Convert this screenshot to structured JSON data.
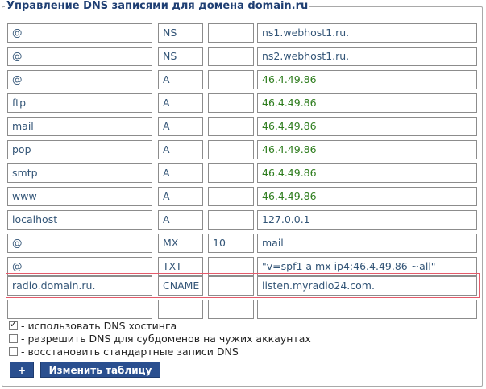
{
  "title": "Управление DNS записями для домена domain.ru",
  "rows": [
    {
      "name": "@",
      "type": "NS",
      "prio": "",
      "value": "ns1.webhost1.ru.",
      "value_color": "default"
    },
    {
      "name": "@",
      "type": "NS",
      "prio": "",
      "value": "ns2.webhost1.ru.",
      "value_color": "default"
    },
    {
      "name": "@",
      "type": "A",
      "prio": "",
      "value": "46.4.49.86",
      "value_color": "green"
    },
    {
      "name": "ftp",
      "type": "A",
      "prio": "",
      "value": "46.4.49.86",
      "value_color": "green"
    },
    {
      "name": "mail",
      "type": "A",
      "prio": "",
      "value": "46.4.49.86",
      "value_color": "green"
    },
    {
      "name": "pop",
      "type": "A",
      "prio": "",
      "value": "46.4.49.86",
      "value_color": "green"
    },
    {
      "name": "smtp",
      "type": "A",
      "prio": "",
      "value": "46.4.49.86",
      "value_color": "green"
    },
    {
      "name": "www",
      "type": "A",
      "prio": "",
      "value": "46.4.49.86",
      "value_color": "green"
    },
    {
      "name": "localhost",
      "type": "A",
      "prio": "",
      "value": "127.0.0.1",
      "value_color": "default"
    },
    {
      "name": "@",
      "type": "MX",
      "prio": "10",
      "value": "mail",
      "value_color": "default"
    },
    {
      "name": "@",
      "type": "TXT",
      "prio": "",
      "value": "\"v=spf1 a mx ip4:46.4.49.86 ~all\"",
      "value_color": "default"
    },
    {
      "name": "radio.domain.ru.",
      "type": "CNAME",
      "prio": "",
      "value": "listen.myradio24.com.",
      "value_color": "default",
      "highlighted": true
    },
    {
      "name": "",
      "type": "",
      "prio": "",
      "value": "",
      "value_color": "default"
    }
  ],
  "options": [
    {
      "label": "- использовать DNS хостинга",
      "checked": true
    },
    {
      "label": "- разрешить DNS для субдоменов на чужих аккаунтах",
      "checked": false
    },
    {
      "label": "- восстановить стандартные записи DNS",
      "checked": false
    }
  ],
  "buttons": {
    "add": "+",
    "save": "Изменить таблицу"
  },
  "colors": {
    "legend": "#1f3f73",
    "ip_value": "#2e7d1e",
    "button_bg": "#2a4f8f",
    "highlight_border": "#e45b6b"
  }
}
